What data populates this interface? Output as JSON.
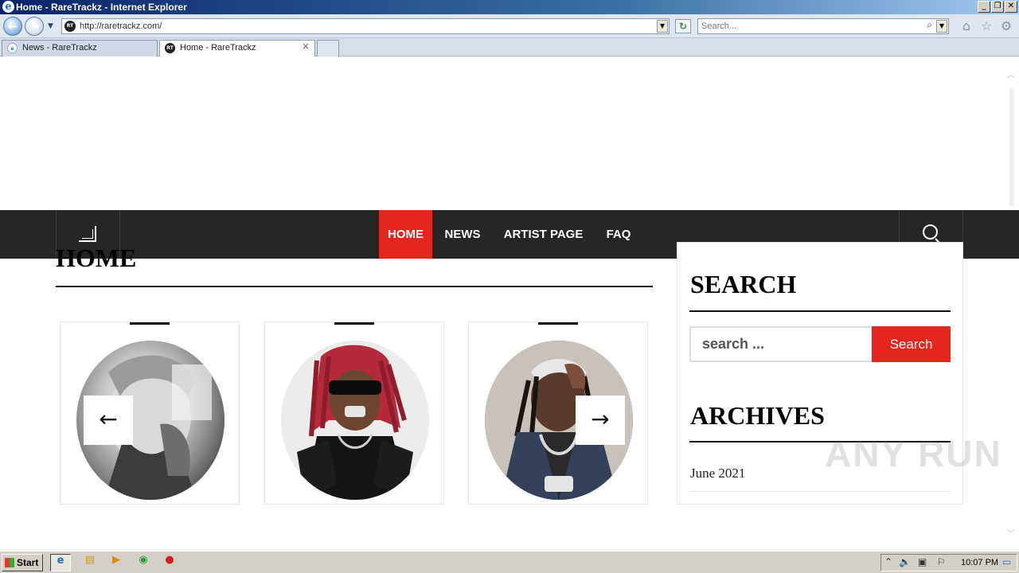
{
  "window": {
    "title": "Home - RareTrackz - Internet Explorer",
    "controls": [
      "_",
      "❐",
      "✕"
    ]
  },
  "toolbar": {
    "back_icon": "←",
    "forward_icon": "→",
    "url": "http://raretrackz.com/",
    "search_placeholder": "Search...",
    "refresh_icon": "↻",
    "home_icon": "⌂",
    "favorites_icon": "☆",
    "tools_icon": "⚙"
  },
  "tabs": [
    {
      "label": "News - RareTrackz",
      "active": false
    },
    {
      "label": "Home - RareTrackz",
      "active": true,
      "close": "×"
    }
  ],
  "favicon_text": "RT",
  "site_nav": {
    "items": [
      {
        "label": "HOME",
        "active": true
      },
      {
        "label": "NEWS",
        "active": false
      },
      {
        "label": "ARTIST PAGE",
        "active": false
      },
      {
        "label": "FAQ",
        "active": false
      }
    ]
  },
  "main": {
    "title": "HOME",
    "carousel": {
      "prev": "←",
      "next": "→",
      "cards": [
        {
          "photo": "artist-photo-1"
        },
        {
          "photo": "artist-photo-2"
        },
        {
          "photo": "artist-photo-3"
        }
      ]
    }
  },
  "sidebar": {
    "search_title": "SEARCH",
    "search_placeholder": "search ...",
    "search_button": "Search",
    "archives_title": "ARCHIVES",
    "archives": [
      "June 2021"
    ]
  },
  "watermark": "ANY RUN",
  "taskbar": {
    "start_label": "Start",
    "clock": "10:07 PM"
  },
  "colors": {
    "accent": "#e5261f",
    "nav_bg": "#262626"
  }
}
